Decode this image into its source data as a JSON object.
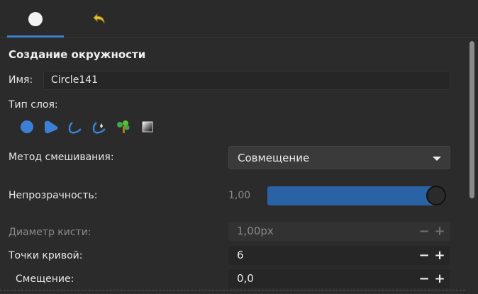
{
  "tabs": [
    {
      "icon": "circle-dot-icon",
      "active": true
    },
    {
      "icon": "undo-arrow-icon",
      "active": false
    }
  ],
  "panel": {
    "title": "Создание окружности",
    "name_label": "Имя:",
    "name_value": "Circle141",
    "layer_type_label": "Тип слоя:",
    "layer_type_icons": [
      "circle-layer-icon",
      "region-layer-icon",
      "outline-layer-icon",
      "advanced-outline-layer-icon",
      "plant-layer-icon",
      "gradient-layer-icon"
    ],
    "blend_label": "Метод смешивания:",
    "blend_value": "Совмещение",
    "opacity_label": "Непрозрачность:",
    "opacity_value": "1,00",
    "opacity_fraction": 1.0,
    "brush_label": "Диаметр кисти:",
    "brush_value": "1,00px",
    "points_label": "Точки кривой:",
    "points_value": "6",
    "offset_label": "Смещение:",
    "offset_value": "0,0",
    "minus": "−",
    "plus": "+"
  },
  "colors": {
    "accent": "#3d7ec9",
    "slider_fill": "#2a62a6",
    "background": "#2b2b2b"
  }
}
